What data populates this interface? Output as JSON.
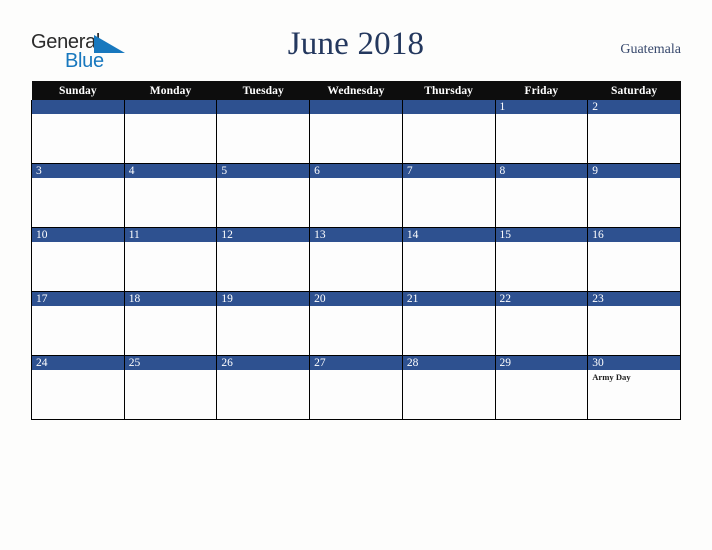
{
  "brand": {
    "name_top": "General",
    "name_bottom": "Blue",
    "triangle_color": "#1878be",
    "top_color": "#2b2b2b",
    "bottom_color": "#1878be"
  },
  "header": {
    "title": "June 2018",
    "country": "Guatemala",
    "title_color": "#24385e",
    "country_color": "#38496d"
  },
  "calendar": {
    "weekday_headers": [
      "Sunday",
      "Monday",
      "Tuesday",
      "Wednesday",
      "Thursday",
      "Friday",
      "Saturday"
    ],
    "header_bg": "#0d0d0d",
    "header_text_color": "#ffffff",
    "date_band_color": "#2e5190",
    "date_text_color": "#ffffff",
    "cell_bg": "#fdfdfd",
    "border_color": "#000000",
    "weeks": [
      [
        {
          "date": "",
          "events": []
        },
        {
          "date": "",
          "events": []
        },
        {
          "date": "",
          "events": []
        },
        {
          "date": "",
          "events": []
        },
        {
          "date": "",
          "events": []
        },
        {
          "date": "1",
          "events": []
        },
        {
          "date": "2",
          "events": []
        }
      ],
      [
        {
          "date": "3",
          "events": []
        },
        {
          "date": "4",
          "events": []
        },
        {
          "date": "5",
          "events": []
        },
        {
          "date": "6",
          "events": []
        },
        {
          "date": "7",
          "events": []
        },
        {
          "date": "8",
          "events": []
        },
        {
          "date": "9",
          "events": []
        }
      ],
      [
        {
          "date": "10",
          "events": []
        },
        {
          "date": "11",
          "events": []
        },
        {
          "date": "12",
          "events": []
        },
        {
          "date": "13",
          "events": []
        },
        {
          "date": "14",
          "events": []
        },
        {
          "date": "15",
          "events": []
        },
        {
          "date": "16",
          "events": []
        }
      ],
      [
        {
          "date": "17",
          "events": []
        },
        {
          "date": "18",
          "events": []
        },
        {
          "date": "19",
          "events": []
        },
        {
          "date": "20",
          "events": []
        },
        {
          "date": "21",
          "events": []
        },
        {
          "date": "22",
          "events": []
        },
        {
          "date": "23",
          "events": []
        }
      ],
      [
        {
          "date": "24",
          "events": []
        },
        {
          "date": "25",
          "events": []
        },
        {
          "date": "26",
          "events": []
        },
        {
          "date": "27",
          "events": []
        },
        {
          "date": "28",
          "events": []
        },
        {
          "date": "29",
          "events": []
        },
        {
          "date": "30",
          "events": [
            "Army Day"
          ]
        }
      ]
    ]
  }
}
